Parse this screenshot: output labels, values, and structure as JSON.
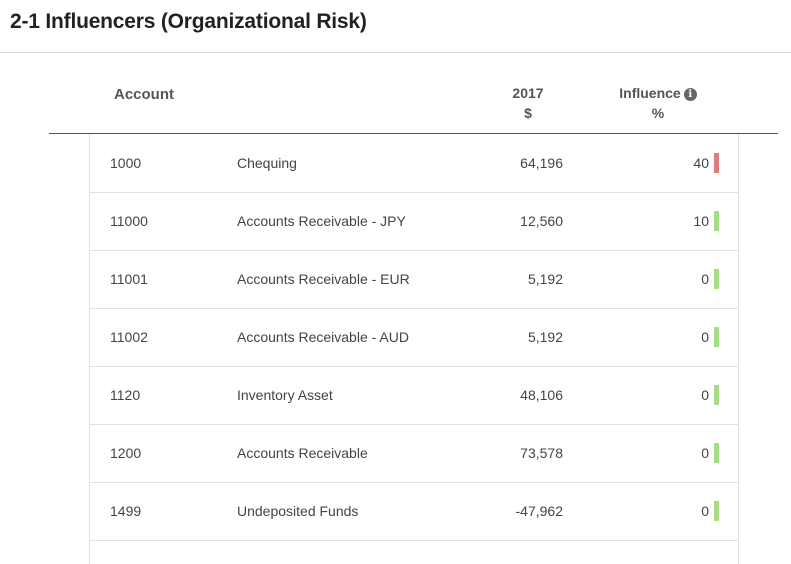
{
  "title": "2-1 Influencers (Organizational Risk)",
  "header": {
    "account": "Account",
    "year": "2017",
    "currency": "$",
    "influence": "Influence",
    "percent": "%"
  },
  "colors": {
    "high": "#e07b7b",
    "low": "#a6dc86"
  },
  "rows": [
    {
      "code": "1000",
      "name": "Chequing",
      "amount": "64,196",
      "influence": "40",
      "level": "high"
    },
    {
      "code": "11000",
      "name": "Accounts Receivable - JPY",
      "amount": "12,560",
      "influence": "10",
      "level": "low"
    },
    {
      "code": "11001",
      "name": "Accounts Receivable - EUR",
      "amount": "5,192",
      "influence": "0",
      "level": "low"
    },
    {
      "code": "11002",
      "name": "Accounts Receivable - AUD",
      "amount": "5,192",
      "influence": "0",
      "level": "low"
    },
    {
      "code": "1120",
      "name": "Inventory Asset",
      "amount": "48,106",
      "influence": "0",
      "level": "low"
    },
    {
      "code": "1200",
      "name": "Accounts Receivable",
      "amount": "73,578",
      "influence": "0",
      "level": "low"
    },
    {
      "code": "1499",
      "name": "Undeposited Funds",
      "amount": "-47,962",
      "influence": "0",
      "level": "low"
    }
  ]
}
